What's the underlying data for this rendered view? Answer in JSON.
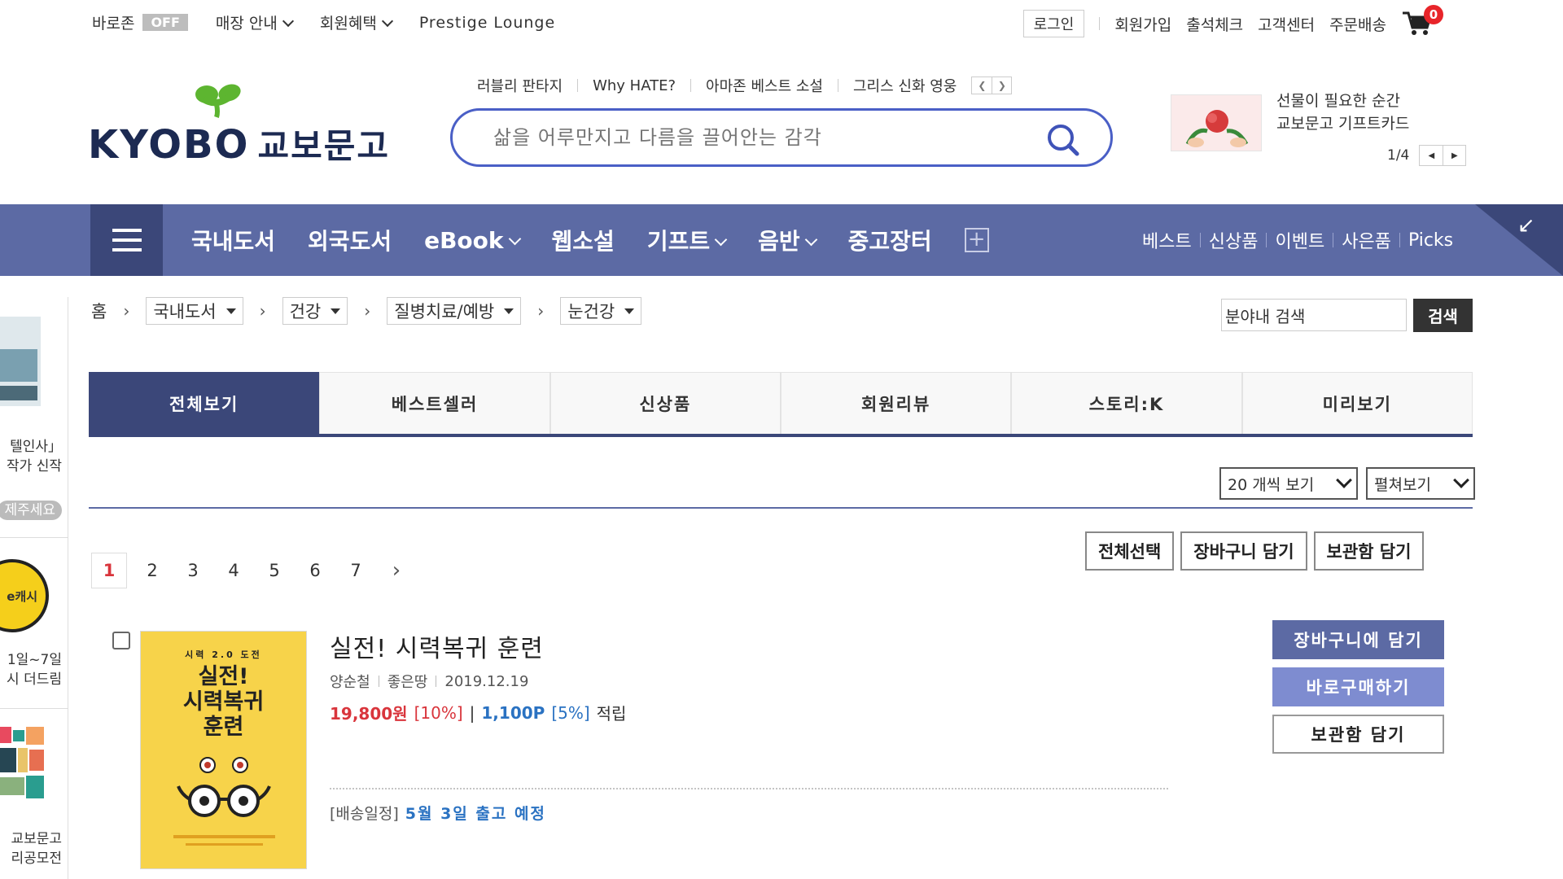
{
  "topbar": {
    "baro_label": "바로존",
    "baro_badge": "OFF",
    "store_info": "매장 안내",
    "member_benefits": "회원혜택",
    "prestige": "Prestige Lounge",
    "login": "로그인",
    "signup": "회원가입",
    "attendance": "출석체크",
    "customer_center": "고객센터",
    "order_delivery": "주문배송",
    "cart_count": "0"
  },
  "logo": {
    "en": "KYOBO",
    "ko": "교보문고"
  },
  "keywords": [
    "러블리 판타지",
    "Why HATE?",
    "아마존 베스트 소설",
    "그리스 신화 영웅"
  ],
  "search": {
    "placeholder": "삶을 어루만지고 다름을 끌어안는 감각"
  },
  "banner": {
    "line1": "선물이 필요한 순간",
    "line2": "교보문고 기프트카드",
    "page": "1/4"
  },
  "nav": {
    "items": [
      "국내도서",
      "외국도서",
      "eBook",
      "웹소설",
      "기프트",
      "음반",
      "중고장터"
    ],
    "right": [
      "베스트",
      "신상품",
      "이벤트",
      "사은품",
      "Picks"
    ]
  },
  "sidebar": {
    "text1a": "텔인사」",
    "text1b": "작가 신작",
    "text1c": "제주세요",
    "ecash": "e캐시",
    "text2a": "1일~7일",
    "text2b": "시 더드림",
    "text3a": "교보문고",
    "text3b": "리공모전"
  },
  "breadcrumb": {
    "home": "홈",
    "c1": "국내도서",
    "c2": "건강",
    "c3": "질병치료/예방",
    "c4": "눈건강"
  },
  "category_search": {
    "value": "분야내 검색",
    "button": "검색"
  },
  "tabs": [
    "전체보기",
    "베스트셀러",
    "신상품",
    "회원리뷰",
    "스토리:K",
    "미리보기"
  ],
  "toolbar": {
    "per_page": "20 개씩 보기",
    "view_mode": "펼쳐보기",
    "pages": [
      "1",
      "2",
      "3",
      "4",
      "5",
      "6",
      "7"
    ],
    "select_all": "전체선택",
    "add_cart": "장바구니 담기",
    "add_wish": "보관함 담기"
  },
  "product": {
    "cover_small": "시력 2.0 도전",
    "cover_title1": "실전!",
    "cover_title2": "시력복귀",
    "cover_title3": "훈련",
    "title": "실전! 시력복귀 훈련",
    "author": "양순철",
    "publisher": "좋은땅",
    "date": "2019.12.19",
    "price": "19,800원",
    "discount": "[10%]",
    "points": "1,100P",
    "points_rate": "[5%]",
    "points_label": "적립",
    "ship_label": "[배송일정]",
    "ship_value": "5월 3일 출고 예정",
    "btn_cart": "장바구니에 담기",
    "btn_buy": "바로구매하기",
    "btn_wish": "보관함 담기"
  },
  "colors": {
    "nav_bg": "#5c6aa4",
    "nav_dark": "#3b4779",
    "search_border": "#4a5fc6",
    "price_red": "#d9353c",
    "points_blue": "#2a72c2"
  }
}
